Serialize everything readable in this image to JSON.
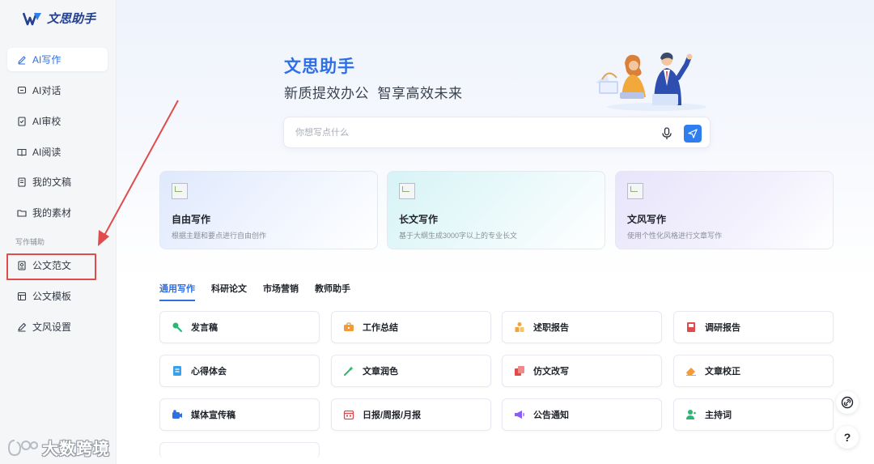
{
  "app": {
    "name": "文思助手"
  },
  "sidebar": {
    "items": [
      {
        "label": "AI写作",
        "icon": "pen-icon",
        "active": true
      },
      {
        "label": "AI对话",
        "icon": "chat-icon"
      },
      {
        "label": "AI审校",
        "icon": "review-icon"
      },
      {
        "label": "AI阅读",
        "icon": "book-icon"
      },
      {
        "label": "我的文稿",
        "icon": "document-icon"
      },
      {
        "label": "我的素材",
        "icon": "folder-icon"
      }
    ],
    "section_title": "写作辅助",
    "tools": [
      {
        "label": "公文范文",
        "icon": "sample-doc-icon",
        "highlighted": true
      },
      {
        "label": "公文模板",
        "icon": "template-icon"
      },
      {
        "label": "文风设置",
        "icon": "style-pen-icon"
      }
    ]
  },
  "hero": {
    "title": "文思助手",
    "subtitle": "新质提效办公  智享高效未来"
  },
  "search": {
    "placeholder": "你想写点什么",
    "mic_icon": "microphone-icon",
    "send_icon": "send-icon"
  },
  "cards": [
    {
      "title": "自由写作",
      "desc": "根据主题和要点进行自由创作"
    },
    {
      "title": "长文写作",
      "desc": "基于大纲生成3000字以上的专业长文"
    },
    {
      "title": "文风写作",
      "desc": "使用个性化风格进行文章写作"
    }
  ],
  "tabs": [
    {
      "label": "通用写作",
      "active": true
    },
    {
      "label": "科研论文"
    },
    {
      "label": "市场营销"
    },
    {
      "label": "教师助手"
    }
  ],
  "tiles": [
    {
      "label": "发言稿",
      "icon": "speech-icon",
      "color": "#2bb673"
    },
    {
      "label": "工作总结",
      "icon": "briefcase-icon",
      "color": "#f29b38"
    },
    {
      "label": "述职报告",
      "icon": "person-report-icon",
      "color": "#f0a53a"
    },
    {
      "label": "调研报告",
      "icon": "research-book-icon",
      "color": "#e04a4a"
    },
    {
      "label": "心得体会",
      "icon": "notebook-icon",
      "color": "#3aa0e8"
    },
    {
      "label": "文章润色",
      "icon": "magic-wand-icon",
      "color": "#2bb673"
    },
    {
      "label": "仿文改写",
      "icon": "copy-icon",
      "color": "#e04a4a"
    },
    {
      "label": "文章校正",
      "icon": "eraser-icon",
      "color": "#f29b38"
    },
    {
      "label": "媒体宣传稿",
      "icon": "camera-icon",
      "color": "#2f6fe6"
    },
    {
      "label": "日报/周报/月报",
      "icon": "calendar-icon",
      "color": "#e04a4a"
    },
    {
      "label": "公告通知",
      "icon": "megaphone-icon",
      "color": "#8b5cf6"
    },
    {
      "label": "主持词",
      "icon": "host-icon",
      "color": "#2bb673"
    }
  ],
  "float_buttons": [
    {
      "label": "",
      "icon": "link-icon"
    },
    {
      "label": "?",
      "icon": "help-icon"
    }
  ],
  "watermark": {
    "text": "大数跨境"
  },
  "colors": {
    "accent": "#2f6fe6",
    "annotation": "#e04b4b",
    "sidebar_bg": "#f5f6f8"
  }
}
